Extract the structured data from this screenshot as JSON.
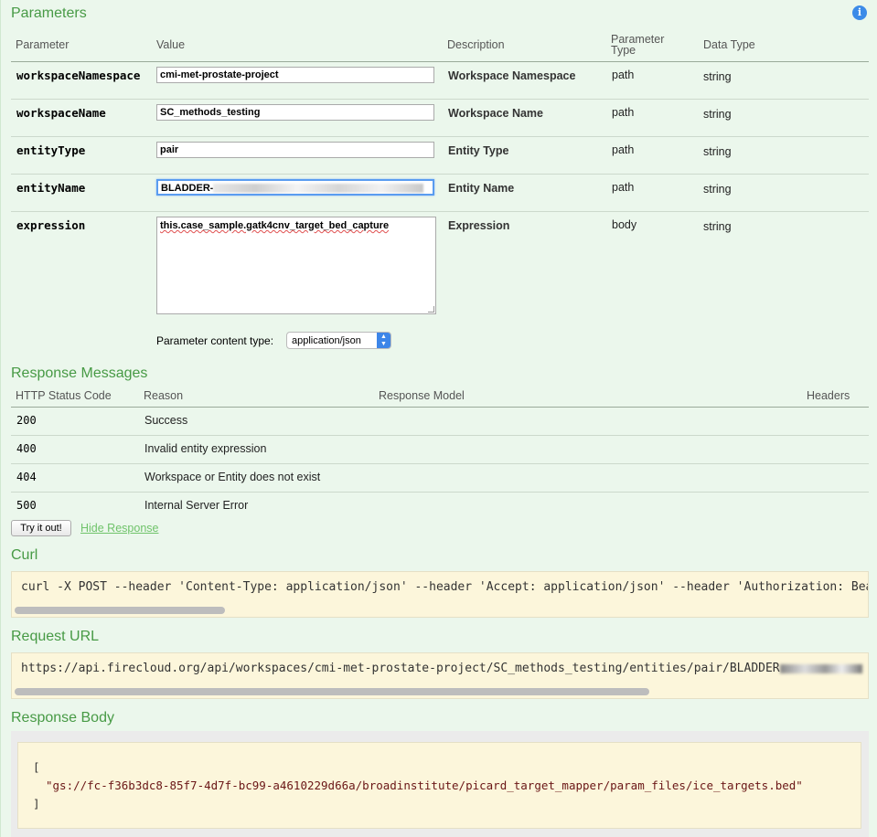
{
  "parameters": {
    "title": "Parameters",
    "headers": {
      "parameter": "Parameter",
      "value": "Value",
      "description": "Description",
      "parameter_type": "Parameter Type",
      "data_type": "Data Type"
    },
    "rows": [
      {
        "name": "workspaceNamespace",
        "value": "cmi-met-prostate-project",
        "description": "Workspace Namespace",
        "type": "path",
        "data_type": "string"
      },
      {
        "name": "workspaceName",
        "value": "SC_methods_testing",
        "description": "Workspace Name",
        "type": "path",
        "data_type": "string"
      },
      {
        "name": "entityType",
        "value": "pair",
        "description": "Entity Type",
        "type": "path",
        "data_type": "string"
      },
      {
        "name": "entityName",
        "value": "BLADDER-",
        "description": "Entity Name",
        "type": "path",
        "data_type": "string"
      },
      {
        "name": "expression",
        "value": "this.case_sample.gatk4cnv_target_bed_capture",
        "description": "Expression",
        "type": "body",
        "data_type": "string"
      }
    ],
    "content_type_label": "Parameter content type:",
    "content_type_value": "application/json"
  },
  "responses": {
    "title": "Response Messages",
    "headers": {
      "code": "HTTP Status Code",
      "reason": "Reason",
      "model": "Response Model",
      "headers": "Headers"
    },
    "rows": [
      {
        "code": "200",
        "reason": "Success"
      },
      {
        "code": "400",
        "reason": "Invalid entity expression"
      },
      {
        "code": "404",
        "reason": "Workspace or Entity does not exist"
      },
      {
        "code": "500",
        "reason": "Internal Server Error"
      }
    ]
  },
  "actions": {
    "try_label": "Try it out!",
    "hide_label": "Hide Response"
  },
  "curl": {
    "title": "Curl",
    "command": "curl -X POST --header 'Content-Type: application/json' --header 'Accept: application/json' --header 'Authorization: Bea"
  },
  "request_url": {
    "title": "Request URL",
    "url": "https://api.firecloud.org/api/workspaces/cmi-met-prostate-project/SC_methods_testing/entities/pair/BLADDER"
  },
  "response_body": {
    "title": "Response Body",
    "open": "[",
    "value": "\"gs://fc-f36b3dc8-85f7-4d7f-bc99-a4610229d66a/broadinstitute/picard_target_mapper/param_files/ice_targets.bed\"",
    "close": "]"
  },
  "icons": {
    "info": "info-icon"
  },
  "colors": {
    "section_title": "#479a45",
    "panel_bg": "#ebf7ec",
    "code_bg": "#fcf6db",
    "info_icon": "#3c8be8",
    "link": "#6fc36a"
  }
}
